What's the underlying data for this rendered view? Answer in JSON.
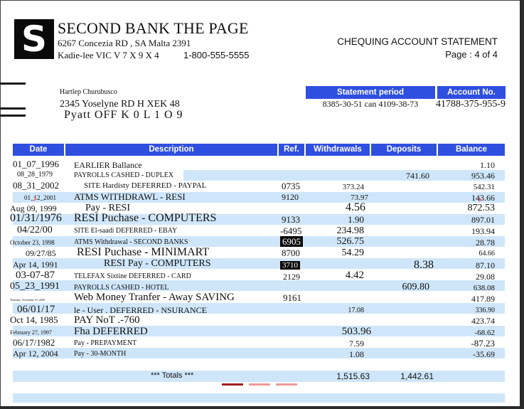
{
  "bank": {
    "logo_letter": "S",
    "name": "SECOND BANK THE PAGE",
    "address1": "6267 Concezia RD , SA Malta 2391",
    "address2": "Kadie-lee VIC V 7 X 9 X 4",
    "phone": "1-800-555-5555"
  },
  "document": {
    "title": "CHEQUING ACCOUNT STATEMENT",
    "page": "Page : 4 of 4"
  },
  "customer": {
    "name": "Hartlep Churubusco",
    "address1": "2345 Yoselyne RD H XEK 48",
    "address2": "Pyatt OFF K 0 L 1 O 9"
  },
  "statement": {
    "period_label": "Statement period",
    "period_value": "8385-30-51 can 4109-38-73",
    "account_label": "Account No.",
    "account_value": "41788-375-955-9"
  },
  "table": {
    "headers": {
      "date": "Date",
      "description": "Description",
      "ref": "Ref.",
      "withdrawals": "Withdrawals",
      "deposits": "Deposits",
      "balance": "Balance"
    },
    "rows": [
      {
        "date": "01_07_1996",
        "desc": "EARLIER Ballance",
        "ref": "",
        "wd": "",
        "dep": "",
        "bal": "1.10"
      },
      {
        "date": "08_28_1979",
        "desc": "PAYROLLS CASHED - DUPLEX",
        "ref": "",
        "wd": "",
        "dep": "741.60",
        "bal": "953.46"
      },
      {
        "date": "08_31_2002",
        "desc": "SITE Hardisty DEFERRED - PAYPAL",
        "ref": "0735",
        "wd": "373.24",
        "dep": "",
        "bal": "542.31"
      },
      {
        "date": "01_12_2001",
        "desc": "ATMS WITHDRAWL - RESI",
        "ref": "9120",
        "wd": "73.97",
        "dep": "",
        "bal": "143.66"
      },
      {
        "date": "Aug 09, 1999",
        "desc": "Pay - RESI",
        "ref": "",
        "wd": "4.56",
        "dep": "",
        "bal": "872.53"
      },
      {
        "date": "01/31/1976",
        "desc": "RESI Puchase - COMPUTERS",
        "ref": "9133",
        "wd": "1.90",
        "dep": "",
        "bal": "897.01"
      },
      {
        "date": "04/22/00",
        "desc": "SITE El-saadi DEFERRED - EBAY",
        "ref": "-6495",
        "wd": "234.98",
        "dep": "",
        "bal": "193.94"
      },
      {
        "date": "October 23, 1998",
        "desc": "ATMS Withdrawal - SECOND BANKS",
        "ref": "6905",
        "wd": "526.75",
        "dep": "",
        "bal": "28.78"
      },
      {
        "date": "09/27/85",
        "desc": "RESI Puchase - MINIMART",
        "ref": "8700",
        "wd": "54.29",
        "dep": "",
        "bal": "64.66"
      },
      {
        "date": "Apr 14, 1991",
        "desc": "RESI Pay - COMPUTERS",
        "ref": "3710",
        "wd": "",
        "dep": "8.38",
        "bal": "87.10"
      },
      {
        "date": "03-07-87",
        "desc": "TELEFAX Sixtine DEFERRED - CARD",
        "ref": "2129",
        "wd": "4.42",
        "dep": "",
        "bal": "29.08"
      },
      {
        "date": "05_23_1991",
        "desc": "PAYROLLS CASHED - HOTEL",
        "ref": "",
        "wd": "",
        "dep": "609.80",
        "bal": "638.08"
      },
      {
        "date": "Thursday, November 19, 2009",
        "desc": "Web Money Tranfer - Away SAVING",
        "ref": "9161",
        "wd": "",
        "dep": "",
        "bal": "417.89"
      },
      {
        "date": "06/01/17",
        "desc": "le - User . DEFERRED - NSURANCE",
        "ref": "",
        "wd": "17.08",
        "dep": "",
        "bal": "336.90"
      },
      {
        "date": "Oct 14, 1985",
        "desc": "PAY NoT .-760",
        "ref": "",
        "wd": "",
        "dep": "",
        "bal": "423.74"
      },
      {
        "date": "February 27, 1997",
        "desc": "Fha DEFERRED",
        "ref": "",
        "wd": "503.96",
        "dep": "",
        "bal": "-68.62"
      },
      {
        "date": "06/17/1982",
        "desc": "Pay - PREPAYMENT",
        "ref": "",
        "wd": "7.59",
        "dep": "",
        "bal": "-87.23"
      },
      {
        "date": "Apr 12, 2004",
        "desc": "Pay - 30-MONTH",
        "ref": "",
        "wd": "1.08",
        "dep": "",
        "bal": "-35.69"
      }
    ],
    "totals": {
      "label": "*** Totals ***",
      "withdrawals": "1,515.63",
      "deposits": "1,442.61"
    }
  },
  "colors": {
    "header_blue": "#2f4fe0",
    "stripe_blue": "#cfe6fa",
    "arrow_red": "#e66a6a"
  }
}
